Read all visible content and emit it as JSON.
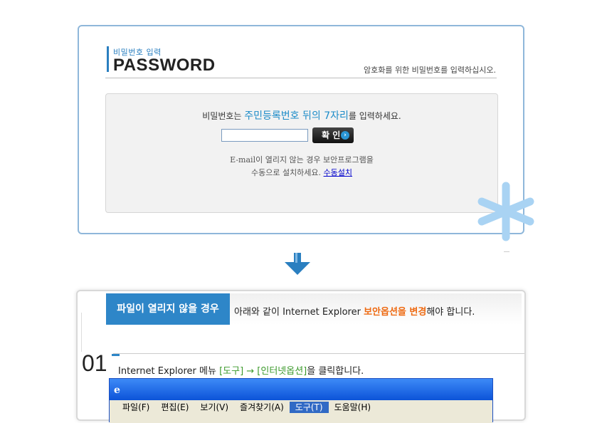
{
  "password_card": {
    "subtitle": "비밀번호 입력",
    "title": "PASSWORD",
    "hint": "암호화를 위한 비밀번호를 입력하십시오.",
    "message_prefix": "비밀번호는",
    "message_highlight": "주민등록번호 뒤의 7자리",
    "message_suffix": "를 입력하세요.",
    "input_value": "",
    "confirm_label": "확 인",
    "note_line1": "E-mail이 열리지 않는 경우 보안프로그램을",
    "note_line2": "수동으로 설치하세요.",
    "manual_install_link": "수동설치"
  },
  "help_card": {
    "banner": "파일이 열리지 않을 경우",
    "text_prefix": "아래와 같이 Internet Explorer",
    "text_highlight": "보안옵션을 변경",
    "text_suffix": "해야 합니다.",
    "step_number": "01",
    "step_prefix": "Internet Explorer 메뉴",
    "step_highlight": "[도구] → [인터넷옵션]",
    "step_suffix": "을 클릭합니다.",
    "ie_menu": [
      "파일(F)",
      "편집(E)",
      "보기(V)",
      "즐겨찾기(A)",
      "도구(T)",
      "도움말(H)"
    ],
    "ie_selected_menu": "도구(T)"
  },
  "colors": {
    "accent_blue": "#2a7fc0",
    "highlight_blue": "#1b8bc8",
    "highlight_orange": "#ee6a12",
    "highlight_green": "#3c9a2c"
  }
}
